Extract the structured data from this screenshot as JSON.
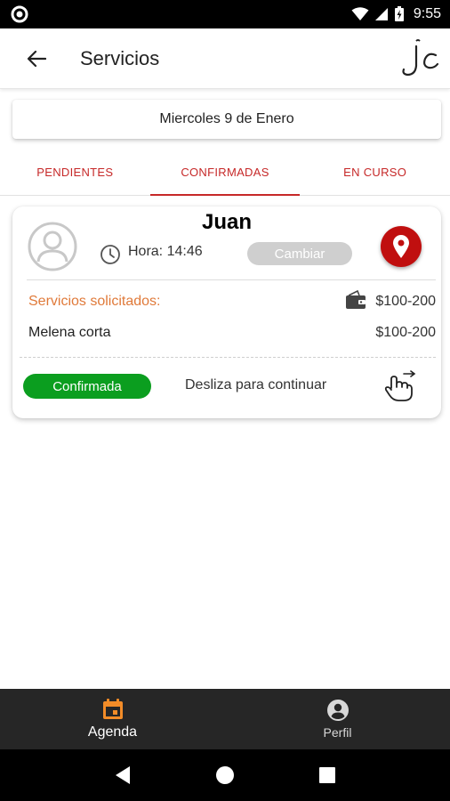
{
  "status_bar": {
    "time": "9:55"
  },
  "app_bar": {
    "title": "Servicios",
    "back_icon": "arrow-left-icon",
    "logo_icon": "jc-logo"
  },
  "date_selector": {
    "label": "Miercoles 9 de Enero"
  },
  "tabs": [
    {
      "label": "PENDIENTES",
      "active": false
    },
    {
      "label": "CONFIRMADAS",
      "active": true
    },
    {
      "label": "EN CURSO",
      "active": false
    }
  ],
  "service_card": {
    "client_name": "Juan",
    "hora": "Hora: 14:46",
    "change_label": "Cambiar",
    "services_label": "Servicios solicitados:",
    "price_range": "$100-200",
    "items": [
      {
        "name": "Melena corta",
        "price": "$100-200"
      }
    ],
    "status": "Confirmada",
    "swipe_hint": "Desliza para continuar"
  },
  "bottom_nav": {
    "items": [
      {
        "label": "Agenda",
        "icon": "calendar-icon",
        "active": true
      },
      {
        "label": "Perfil",
        "icon": "account-circle-icon",
        "active": false
      }
    ]
  },
  "colors": {
    "accent_red": "#c62828",
    "location_red": "#c00f0f",
    "confirmed_green": "#0b9e1f",
    "services_orange": "#e07a3a",
    "nav_active_orange": "#f28c28",
    "nav_bg": "#262626"
  }
}
